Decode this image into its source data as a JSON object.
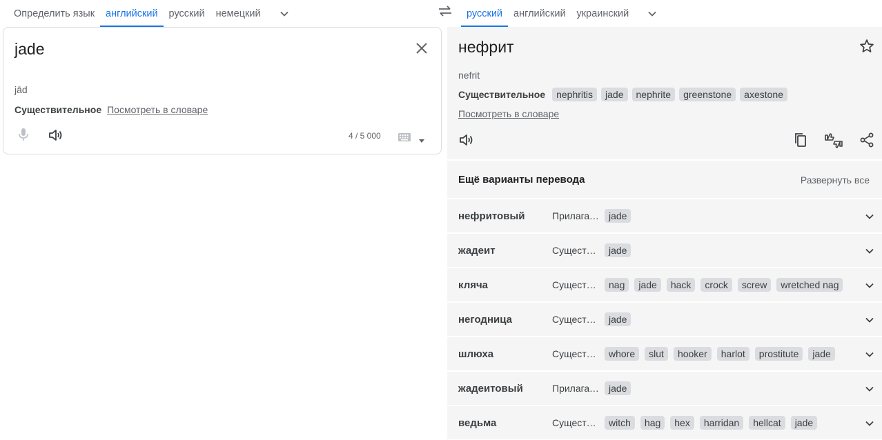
{
  "source_langs": {
    "tabs": [
      "Определить язык",
      "английский",
      "русский",
      "немецкий"
    ],
    "active": 1
  },
  "target_langs": {
    "tabs": [
      "русский",
      "английский",
      "украинский"
    ],
    "active": 0
  },
  "source": {
    "text": "jade",
    "transliteration": "jād",
    "pos_label": "Существительное",
    "dict_link": "Посмотреть в словаре",
    "char_count": "4 / 5 000"
  },
  "target": {
    "text": "нефрит",
    "transliteration": "nefrit",
    "pos_label": "Существительное",
    "synonyms": [
      "nephritis",
      "jade",
      "nephrite",
      "greenstone",
      "axestone"
    ],
    "dict_link": "Посмотреть в словаре"
  },
  "alternatives": {
    "title": "Ещё варианты перевода",
    "expand_all": "Развернуть все",
    "rows": [
      {
        "word": "нефритовый",
        "pos": "Прилагательное",
        "chips": [
          "jade"
        ]
      },
      {
        "word": "жадеит",
        "pos": "Существительное",
        "chips": [
          "jade"
        ]
      },
      {
        "word": "кляча",
        "pos": "Существительное",
        "chips": [
          "nag",
          "jade",
          "hack",
          "crock",
          "screw",
          "wretched nag"
        ]
      },
      {
        "word": "негодница",
        "pos": "Существительное",
        "chips": [
          "jade"
        ]
      },
      {
        "word": "шлюха",
        "pos": "Существительное",
        "chips": [
          "whore",
          "slut",
          "hooker",
          "harlot",
          "prostitute",
          "jade"
        ]
      },
      {
        "word": "жадеитовый",
        "pos": "Прилагательное",
        "chips": [
          "jade"
        ]
      },
      {
        "word": "ведьма",
        "pos": "Существительное",
        "chips": [
          "witch",
          "hag",
          "hex",
          "harridan",
          "hellcat",
          "jade"
        ]
      }
    ]
  },
  "icons": {
    "swap": "swap-icon",
    "clear": "close-icon",
    "mic": "mic-icon",
    "speaker": "speaker-icon",
    "keyboard": "keyboard-icon",
    "star": "star-icon",
    "copy": "copy-icon",
    "rate": "thumbs-icon",
    "share": "share-icon",
    "chevron": "chevron-down-icon"
  },
  "colors": {
    "accent": "#1a73e8",
    "panel": "#f5f5f5",
    "chip": "#dadce0"
  }
}
